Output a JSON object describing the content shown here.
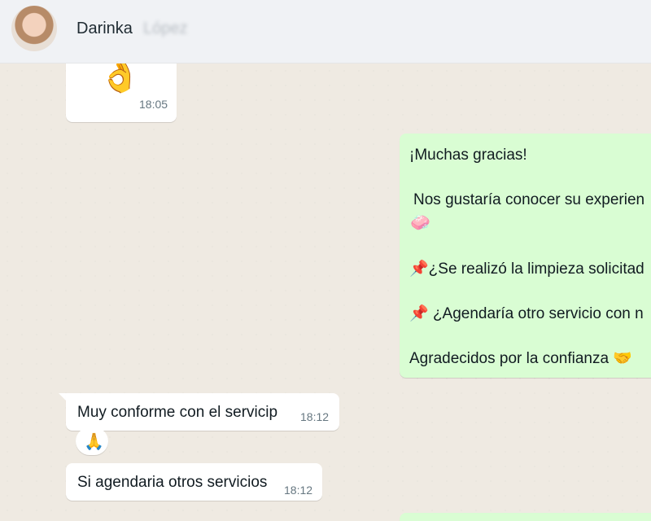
{
  "header": {
    "contact_name": "Darinka",
    "contact_surname": "López"
  },
  "messages": {
    "m1": {
      "emoji": "👌",
      "time": "18:05"
    },
    "m2": {
      "line1": "¡Muchas gracias!",
      "line2": "Nos gustaría conocer su experien",
      "line3_emoji": "🧼",
      "line4_emoji": "📌",
      "line4": "¿Se realizó la limpieza solicitad",
      "line5_emoji": "📌",
      "line5": " ¿Agendaría otro servicio con n",
      "line6": "Agradecidos por la confianza",
      "line6_emoji": "🤝"
    },
    "m3": {
      "text": "Muy conforme con el servicip",
      "time": "18:12"
    },
    "m4": {
      "emoji": "🙏"
    },
    "m5": {
      "text": "Si agendaria otros servicios",
      "time": "18:12"
    }
  }
}
